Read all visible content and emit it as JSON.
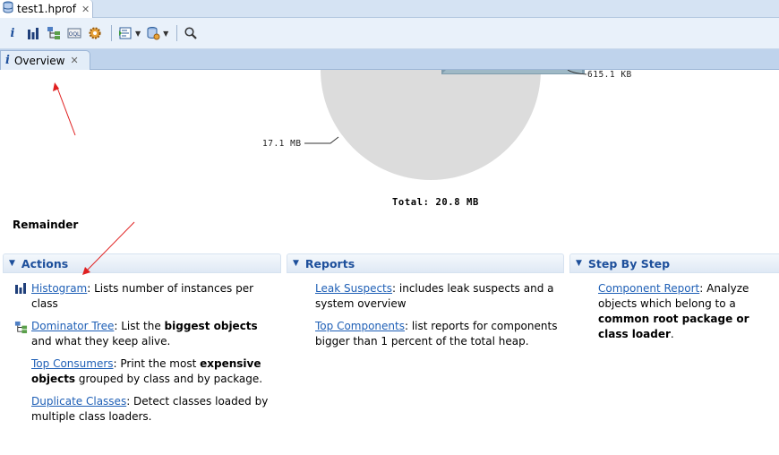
{
  "editor_tab": {
    "label": "test1.hprof"
  },
  "view_tab": {
    "label": "Overview"
  },
  "toolbar": {
    "icons": [
      "info-icon",
      "histogram-icon",
      "dominator-tree-icon",
      "oql-icon",
      "gear-icon",
      "query-browser-icon",
      "heap-dump-icon",
      "search-icon"
    ]
  },
  "chart_data": {
    "type": "pie",
    "total_label": "Total: 20.8 MB",
    "slices": [
      {
        "label": "17.1 MB",
        "value": 17.1
      },
      {
        "label": "615.1 KB",
        "value": 0.6
      }
    ]
  },
  "remainder_label": "Remainder",
  "sections": {
    "actions": {
      "title": "Actions",
      "items": [
        {
          "link": "Histogram",
          "pre": ": Lists number of instances per class",
          "bold": "",
          "post": ""
        },
        {
          "link": "Dominator Tree",
          "pre": ": List the ",
          "bold": "biggest objects",
          "post": " and what they keep alive."
        },
        {
          "link": "Top Consumers",
          "pre": ": Print the most ",
          "bold": "expensive objects",
          "post": " grouped by class and by package."
        },
        {
          "link": "Duplicate Classes",
          "pre": ": Detect classes loaded by multiple class loaders.",
          "bold": "",
          "post": ""
        }
      ]
    },
    "reports": {
      "title": "Reports",
      "items": [
        {
          "link": "Leak Suspects",
          "pre": ": includes leak suspects and a system overview",
          "bold": "",
          "post": ""
        },
        {
          "link": "Top Components",
          "pre": ": list reports for components bigger than 1 percent of the total heap.",
          "bold": "",
          "post": ""
        }
      ]
    },
    "step_by_step": {
      "title": "Step By Step",
      "items": [
        {
          "link": "Component Report",
          "pre": ": Analyze objects which belong to a ",
          "bold": "common root package or class loader",
          "post": "."
        }
      ]
    }
  },
  "colors": {
    "link": "#1e5fb6",
    "header_text": "#1d4f9b",
    "pie_gray": "#dcdcdc",
    "arrow": "#e02020"
  }
}
